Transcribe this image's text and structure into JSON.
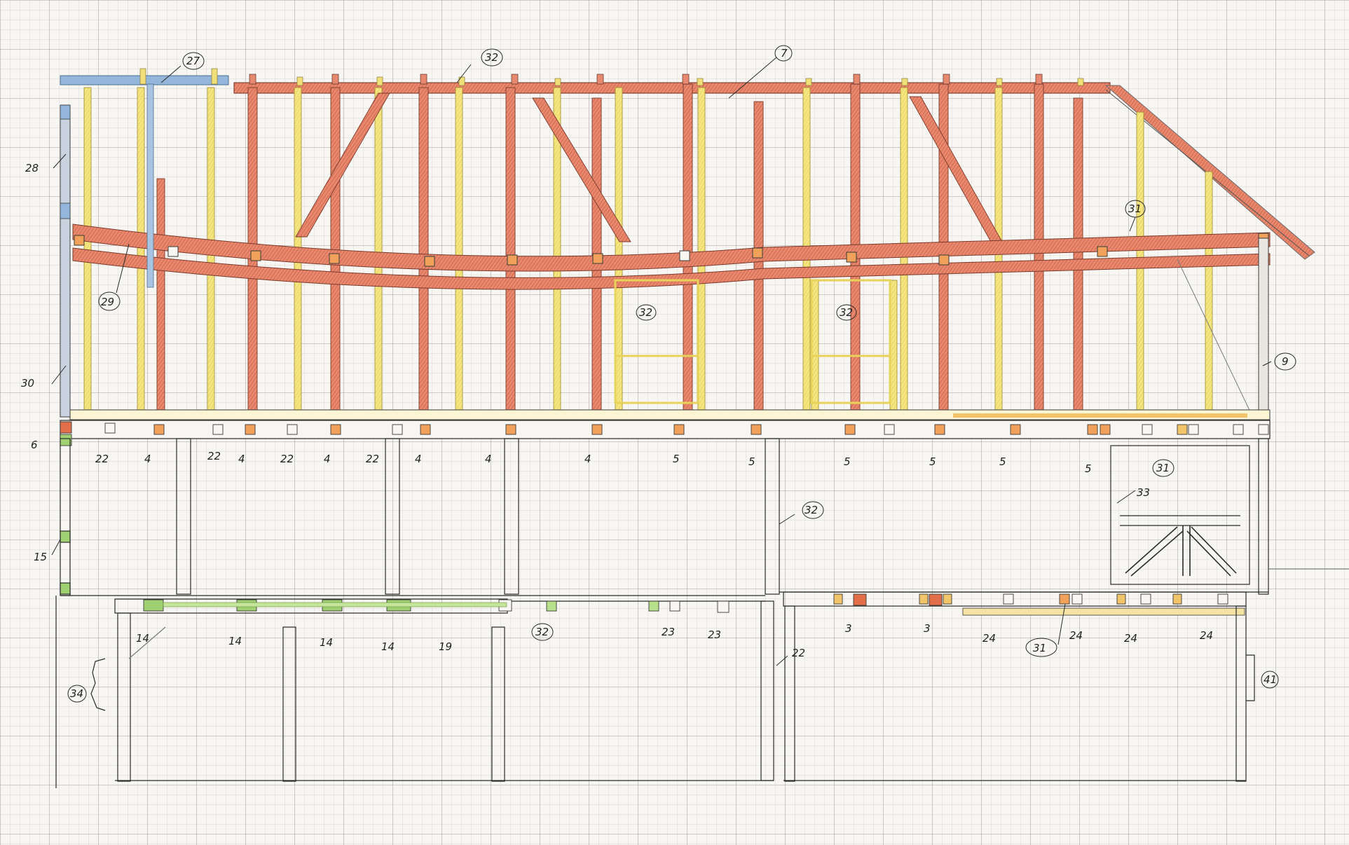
{
  "colors": {
    "paper": "#f7f6f2",
    "grid_minor": "#c9c9c4",
    "grid_major": "#9c9c96",
    "ink": "#2a2a2a",
    "red_timber": "#e07b63",
    "red_timber_dark": "#c9503a",
    "yellow_timber": "#f0df6a",
    "blue_timber": "#8fb4d9",
    "green_timber": "#9fd071",
    "orange_mortise": "#f2a15a"
  },
  "labels": {
    "l27": "27",
    "l32_top": "32",
    "l7": "7",
    "l28": "28",
    "l29": "29",
    "l31_right": "31",
    "l32_mid_a": "32",
    "l32_mid_b": "32",
    "l30": "30",
    "l9": "9",
    "l6": "6",
    "l22_a": "22",
    "l4_a": "4",
    "l22_b": "22",
    "l4_b": "4",
    "l22_c": "22",
    "l4_c": "4",
    "l22_d": "22",
    "l4_d": "4",
    "l4_e": "4",
    "l4_f": "4",
    "l5_a": "5",
    "l5_b": "5",
    "l5_c": "5",
    "l5_d": "5",
    "l5_e": "5",
    "l5_f": "5",
    "l31_mid": "31",
    "l33": "33",
    "l32_lower": "32",
    "l15": "15",
    "l14_a": "14",
    "l14_b": "14",
    "l14_c": "14",
    "l14_d": "14",
    "l19": "19",
    "l32_low": "32",
    "l23_a": "23",
    "l23_b": "23",
    "l22_low": "22",
    "l3_a": "3",
    "l3_b": "3",
    "l24_a": "24",
    "l31_low": "31",
    "l24_b": "24",
    "l24_c": "24",
    "l24_d": "24",
    "l34": "34",
    "l41": "41"
  }
}
